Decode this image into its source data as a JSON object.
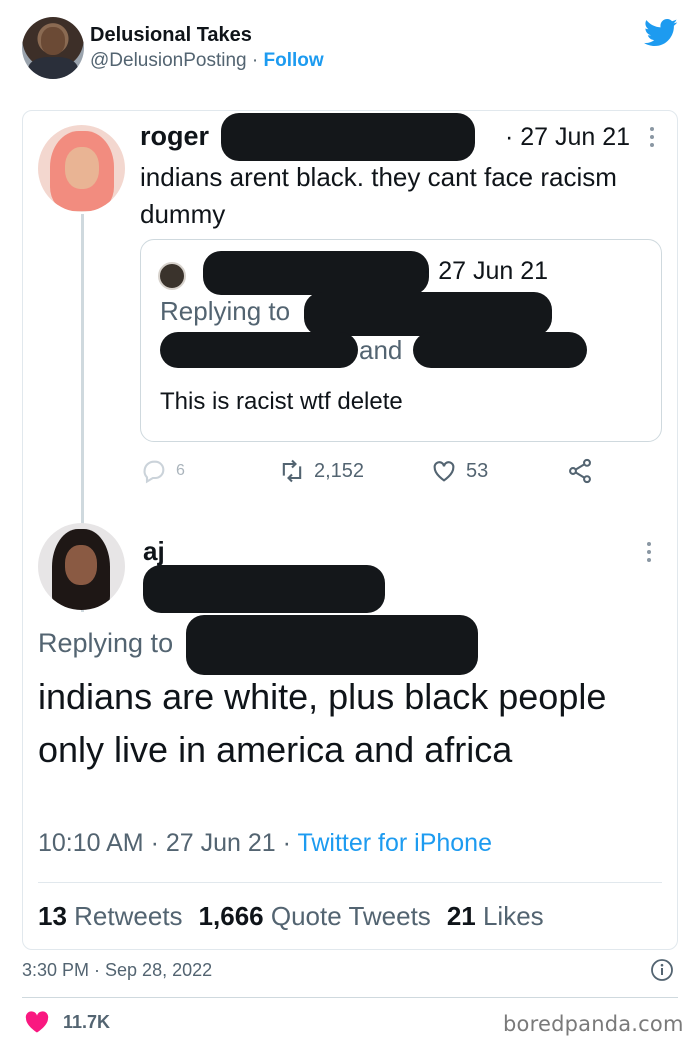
{
  "embed": {
    "display_name": "Delusional Takes",
    "handle": "@DelusionPosting",
    "separator": " · ",
    "follow_label": "Follow",
    "posted_time": "3:30 PM · Sep 28, 2022",
    "like_count": "11.7K",
    "accent_color": "#1d9bf0",
    "like_color": "#f91880"
  },
  "screenshot": {
    "first_tweet": {
      "author_name": "roger",
      "date": "· 27 Jun 21",
      "text": "indians arent black. they cant face racism dummy",
      "quoted": {
        "date": "· 27 Jun 21",
        "replying_to_label": "Replying to",
        "and_label": "and",
        "text": "This is racist wtf delete"
      },
      "actions": {
        "replies": "6",
        "retweets": "2,152",
        "likes": "53"
      }
    },
    "reply_tweet": {
      "author_name": "aj",
      "replying_to_label": "Replying to",
      "text": "indians are white, plus black people only live in america and africa",
      "time": "10:10 AM",
      "date": "27 Jun 21",
      "source": "Twitter for iPhone",
      "meta_separator": " · ",
      "stats": {
        "retweets_count": "13",
        "retweets_label": "Retweets",
        "quotes_count": "1,666",
        "quotes_label": "Quote Tweets",
        "likes_count": "21",
        "likes_label": "Likes"
      }
    }
  },
  "watermark": "boredpanda.com"
}
